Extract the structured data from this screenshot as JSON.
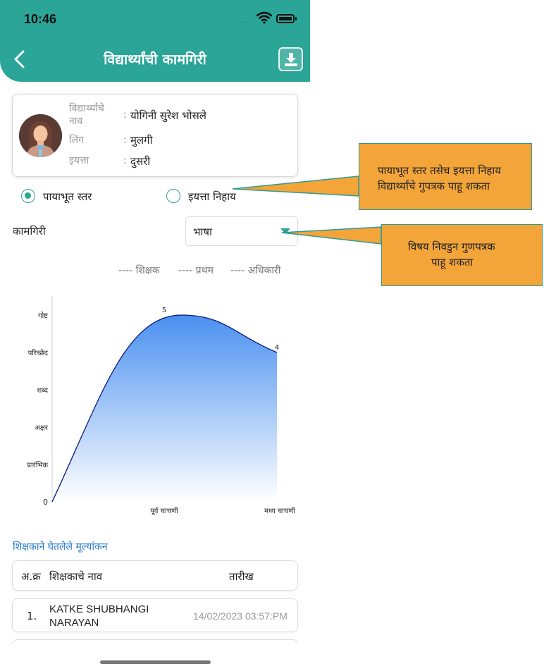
{
  "status_bar": {
    "time": "10:46",
    "dots": "....",
    "wifi_icon": "wifi-icon",
    "battery_icon": "battery-icon"
  },
  "header": {
    "title": "विद्यार्थ्यांची कामगिरी",
    "back_icon": "chevron-left-icon",
    "download_icon": "download-icon",
    "bg_color": "#2aa597"
  },
  "student": {
    "name_label_line1": "विद्यार्थ्याचे",
    "name_label_line2": "नाव",
    "name_value": "योगिनी सुरेश भोसले",
    "gender_label": "लिंग",
    "gender_value": "मुलगी",
    "class_label": "इयत्ता",
    "class_value": "दुसरी",
    "colon": ":"
  },
  "filters": {
    "option_level": "पायाभूत स्तर",
    "option_class": "इयत्ता निहाय",
    "selected": "option_level",
    "performance_label": "कामगिरी",
    "subject_value": "भाषा"
  },
  "legend": {
    "teacher": "---- शिक्षक",
    "pratham": "---- प्रथम",
    "officer": "---- अधिकारी"
  },
  "chart_data": {
    "type": "area",
    "x": [
      "",
      "पूर्व चाचणी",
      "मध्य चाचणी"
    ],
    "y_categories": [
      "0",
      "प्रारंभिक",
      "अक्षर",
      "शब्द",
      "परिच्छेद",
      "गोष्ट"
    ],
    "series": [
      {
        "values": [
          0,
          5,
          4
        ]
      }
    ],
    "data_labels": [
      "",
      "5",
      "4"
    ],
    "ylim": [
      0,
      5
    ],
    "grid": false,
    "colors": {
      "line": "#0a1a7a",
      "fill_top": "#4a90f0",
      "fill_bottom": "#ffffff"
    }
  },
  "callouts": {
    "radio_note_line1": "पायाभूत स्तर तसेच इयत्ता निहाय",
    "radio_note_line2": "विद्यार्थ्यांचे गुपत्रक पाहू शकता",
    "subject_note_line1": "विषय निवडुन गुणपत्रक",
    "subject_note_line2": "पाहू शकता"
  },
  "evaluations": {
    "title": "शिक्षकाने घेतलेले मूल्यांकन",
    "columns": [
      "अ.क्र",
      "शिक्षकाचे नाव",
      "तारीख"
    ],
    "rows": [
      {
        "index": "1.",
        "name_line1": "KATKE SHUBHANGI",
        "name_line2": "NARAYAN",
        "date": "14/02/2023 03:57:PM"
      }
    ]
  }
}
